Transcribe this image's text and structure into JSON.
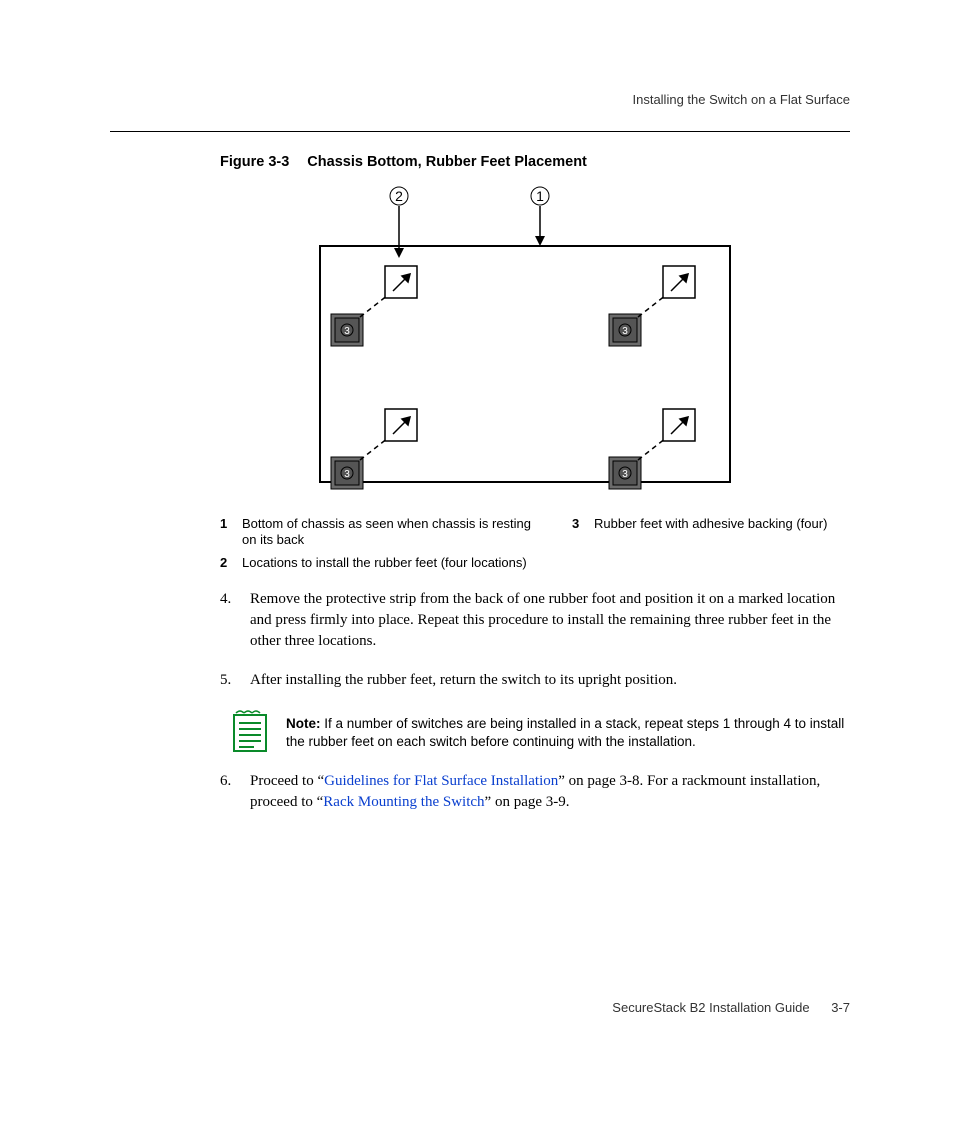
{
  "header": {
    "section_title": "Installing the Switch on a Flat Surface"
  },
  "figure": {
    "label": "Figure 3-3",
    "title": "Chassis Bottom, Rubber Feet Placement",
    "callouts": {
      "one": "À",
      "two": "Á",
      "three": "Â"
    }
  },
  "legend": {
    "items": [
      {
        "num": "1",
        "text": "Bottom of chassis as seen when chassis is resting on its back"
      },
      {
        "num": "2",
        "text": "Locations to install the rubber feet (four locations)"
      },
      {
        "num": "3",
        "text": "Rubber feet with adhesive backing (four)"
      }
    ]
  },
  "steps": {
    "s4": {
      "num": "4.",
      "text": "Remove the protective strip from the back of one rubber foot and position it on a marked location and press firmly into place. Repeat this procedure to install the remaining three rubber feet in the other three locations."
    },
    "s5": {
      "num": "5.",
      "text": "After installing the rubber feet, return the switch to its upright position."
    },
    "s6": {
      "num": "6.",
      "pre": "Proceed to “",
      "link1": "Guidelines for Flat Surface Installation",
      "mid": "” on page 3-8. For a rackmount installation, proceed to “",
      "link2": "Rack Mounting the Switch",
      "post": "” on page 3-9."
    }
  },
  "note": {
    "label": "Note:",
    "text": " If a number of switches are being installed in a stack, repeat steps 1 through 4 to install the rubber feet on each switch before continuing with the installation."
  },
  "footer": {
    "doc": "SecureStack B2 Installation Guide",
    "page": "3-7"
  }
}
